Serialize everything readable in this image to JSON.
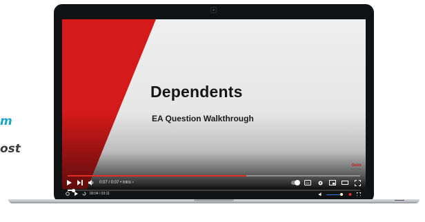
{
  "side_text": {
    "line1": "m",
    "line2": "ost"
  },
  "video": {
    "title": "Dependents",
    "subtitle": "EA Question Walkthrough",
    "logo": "Gleim",
    "logo_sub": "Exam Prep",
    "chapter_time": "0:07 / 0:07 • Intro",
    "chapter_chevron": "›",
    "progress_fraction": 0.61
  },
  "player": {
    "time": "00:04 / 03:11",
    "seek_fraction": 0.02,
    "volume_fraction": 0.9
  },
  "colors": {
    "accent_red": "#d41a1a",
    "teal": "#1aa3c9",
    "volume_blue": "#2a7be4"
  },
  "icons": {
    "play": "play-icon",
    "next": "skip-next-icon",
    "volume": "volume-icon",
    "autoplay": "autoplay-toggle-icon",
    "captions": "closed-captions-icon",
    "settings": "gear-icon",
    "miniplayer": "miniplayer-icon",
    "theater": "theater-mode-icon",
    "fullscreen": "fullscreen-icon",
    "rewind": "rewind-icon",
    "replay": "replay-icon",
    "cast": "cast-icon"
  }
}
